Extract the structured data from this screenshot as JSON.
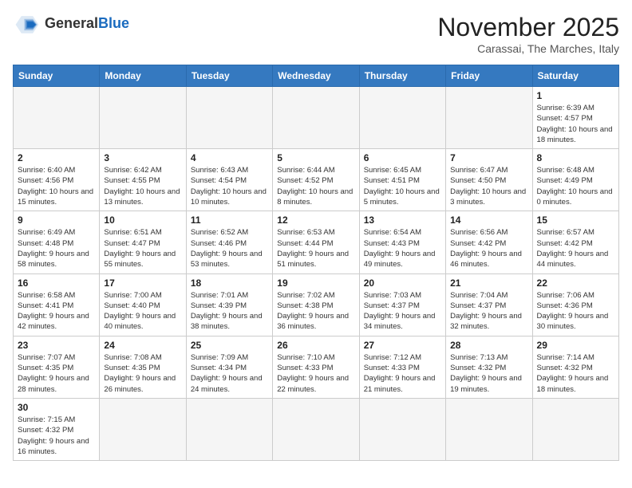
{
  "header": {
    "logo_general": "General",
    "logo_blue": "Blue",
    "month_title": "November 2025",
    "location": "Carassai, The Marches, Italy"
  },
  "weekdays": [
    "Sunday",
    "Monday",
    "Tuesday",
    "Wednesday",
    "Thursday",
    "Friday",
    "Saturday"
  ],
  "weeks": [
    [
      {
        "day": "",
        "empty": true
      },
      {
        "day": "",
        "empty": true
      },
      {
        "day": "",
        "empty": true
      },
      {
        "day": "",
        "empty": true
      },
      {
        "day": "",
        "empty": true
      },
      {
        "day": "",
        "empty": true
      },
      {
        "day": "1",
        "sunrise": "6:39 AM",
        "sunset": "4:57 PM",
        "daylight": "10 hours and 18 minutes."
      }
    ],
    [
      {
        "day": "2",
        "sunrise": "6:40 AM",
        "sunset": "4:56 PM",
        "daylight": "10 hours and 15 minutes."
      },
      {
        "day": "3",
        "sunrise": "6:42 AM",
        "sunset": "4:55 PM",
        "daylight": "10 hours and 13 minutes."
      },
      {
        "day": "4",
        "sunrise": "6:43 AM",
        "sunset": "4:54 PM",
        "daylight": "10 hours and 10 minutes."
      },
      {
        "day": "5",
        "sunrise": "6:44 AM",
        "sunset": "4:52 PM",
        "daylight": "10 hours and 8 minutes."
      },
      {
        "day": "6",
        "sunrise": "6:45 AM",
        "sunset": "4:51 PM",
        "daylight": "10 hours and 5 minutes."
      },
      {
        "day": "7",
        "sunrise": "6:47 AM",
        "sunset": "4:50 PM",
        "daylight": "10 hours and 3 minutes."
      },
      {
        "day": "8",
        "sunrise": "6:48 AM",
        "sunset": "4:49 PM",
        "daylight": "10 hours and 0 minutes."
      }
    ],
    [
      {
        "day": "9",
        "sunrise": "6:49 AM",
        "sunset": "4:48 PM",
        "daylight": "9 hours and 58 minutes."
      },
      {
        "day": "10",
        "sunrise": "6:51 AM",
        "sunset": "4:47 PM",
        "daylight": "9 hours and 55 minutes."
      },
      {
        "day": "11",
        "sunrise": "6:52 AM",
        "sunset": "4:46 PM",
        "daylight": "9 hours and 53 minutes."
      },
      {
        "day": "12",
        "sunrise": "6:53 AM",
        "sunset": "4:44 PM",
        "daylight": "9 hours and 51 minutes."
      },
      {
        "day": "13",
        "sunrise": "6:54 AM",
        "sunset": "4:43 PM",
        "daylight": "9 hours and 49 minutes."
      },
      {
        "day": "14",
        "sunrise": "6:56 AM",
        "sunset": "4:42 PM",
        "daylight": "9 hours and 46 minutes."
      },
      {
        "day": "15",
        "sunrise": "6:57 AM",
        "sunset": "4:42 PM",
        "daylight": "9 hours and 44 minutes."
      }
    ],
    [
      {
        "day": "16",
        "sunrise": "6:58 AM",
        "sunset": "4:41 PM",
        "daylight": "9 hours and 42 minutes."
      },
      {
        "day": "17",
        "sunrise": "7:00 AM",
        "sunset": "4:40 PM",
        "daylight": "9 hours and 40 minutes."
      },
      {
        "day": "18",
        "sunrise": "7:01 AM",
        "sunset": "4:39 PM",
        "daylight": "9 hours and 38 minutes."
      },
      {
        "day": "19",
        "sunrise": "7:02 AM",
        "sunset": "4:38 PM",
        "daylight": "9 hours and 36 minutes."
      },
      {
        "day": "20",
        "sunrise": "7:03 AM",
        "sunset": "4:37 PM",
        "daylight": "9 hours and 34 minutes."
      },
      {
        "day": "21",
        "sunrise": "7:04 AM",
        "sunset": "4:37 PM",
        "daylight": "9 hours and 32 minutes."
      },
      {
        "day": "22",
        "sunrise": "7:06 AM",
        "sunset": "4:36 PM",
        "daylight": "9 hours and 30 minutes."
      }
    ],
    [
      {
        "day": "23",
        "sunrise": "7:07 AM",
        "sunset": "4:35 PM",
        "daylight": "9 hours and 28 minutes."
      },
      {
        "day": "24",
        "sunrise": "7:08 AM",
        "sunset": "4:35 PM",
        "daylight": "9 hours and 26 minutes."
      },
      {
        "day": "25",
        "sunrise": "7:09 AM",
        "sunset": "4:34 PM",
        "daylight": "9 hours and 24 minutes."
      },
      {
        "day": "26",
        "sunrise": "7:10 AM",
        "sunset": "4:33 PM",
        "daylight": "9 hours and 22 minutes."
      },
      {
        "day": "27",
        "sunrise": "7:12 AM",
        "sunset": "4:33 PM",
        "daylight": "9 hours and 21 minutes."
      },
      {
        "day": "28",
        "sunrise": "7:13 AM",
        "sunset": "4:32 PM",
        "daylight": "9 hours and 19 minutes."
      },
      {
        "day": "29",
        "sunrise": "7:14 AM",
        "sunset": "4:32 PM",
        "daylight": "9 hours and 18 minutes."
      }
    ],
    [
      {
        "day": "30",
        "sunrise": "7:15 AM",
        "sunset": "4:32 PM",
        "daylight": "9 hours and 16 minutes."
      },
      {
        "day": "",
        "empty": true
      },
      {
        "day": "",
        "empty": true
      },
      {
        "day": "",
        "empty": true
      },
      {
        "day": "",
        "empty": true
      },
      {
        "day": "",
        "empty": true
      },
      {
        "day": "",
        "empty": true
      }
    ]
  ]
}
